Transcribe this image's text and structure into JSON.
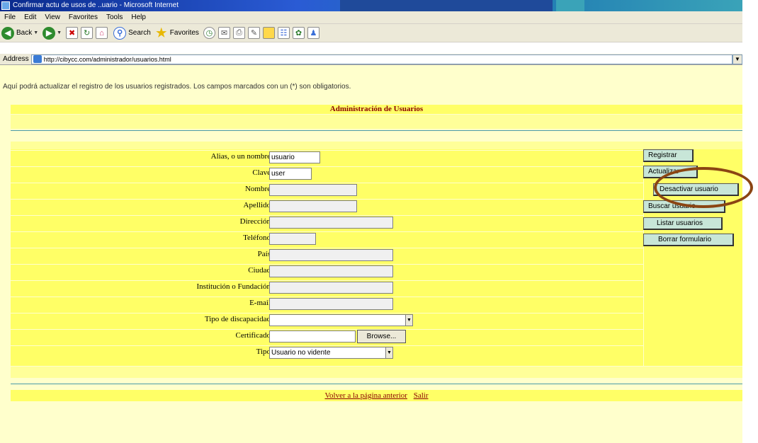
{
  "window": {
    "title": "Confirmar actu de usos de ..uario - Microsoft Internet"
  },
  "menu": [
    "File",
    "Edit",
    "View",
    "Favorites",
    "Tools",
    "Help"
  ],
  "toolbar": {
    "back": "Back",
    "search": "Search",
    "favorites": "Favorites"
  },
  "address": {
    "label": "Address",
    "url": "http://cibycc.com/administrador/usuarios.html"
  },
  "page": {
    "intro": "Aquí podrá actualizar el registro de los usuarios registrados. Los campos marcados con un (*) son obligatorios.",
    "section_title": "Administración de Usuarios",
    "fields": [
      {
        "label": "Alias, o un nombre",
        "value": "usuario"
      },
      {
        "label": "Clave",
        "value": "user"
      },
      {
        "label": "Nombre",
        "value": ""
      },
      {
        "label": "Apellido",
        "value": ""
      },
      {
        "label": "Dirección",
        "value": ""
      },
      {
        "label": "Teléfono",
        "value": ""
      },
      {
        "label": "País",
        "value": ""
      },
      {
        "label": "Ciudad",
        "value": ""
      },
      {
        "label": "Institución o Fundación",
        "value": ""
      },
      {
        "label": "E-mail",
        "value": ""
      },
      {
        "label": "Tipo de discapacidad",
        "value": ""
      },
      {
        "label": "Certificado",
        "value": ""
      },
      {
        "label": "Tipo",
        "value": "Usuario no vidente"
      }
    ],
    "browse_label": "Browse...",
    "buttons": [
      "Registrar",
      "Actualizar",
      "Desactivar usuario",
      "Buscar usuario",
      "Listar usuarios",
      "Borrar formulario"
    ],
    "footer": {
      "back_link": "Volver a la página anterior",
      "exit_link": "Salir"
    }
  },
  "colors": {
    "page_bg": "#ffffcc",
    "band": "#ffff66",
    "title_text": "#8b0000",
    "button_bg": "#c8e6d8",
    "highlight": "#8b4513"
  }
}
